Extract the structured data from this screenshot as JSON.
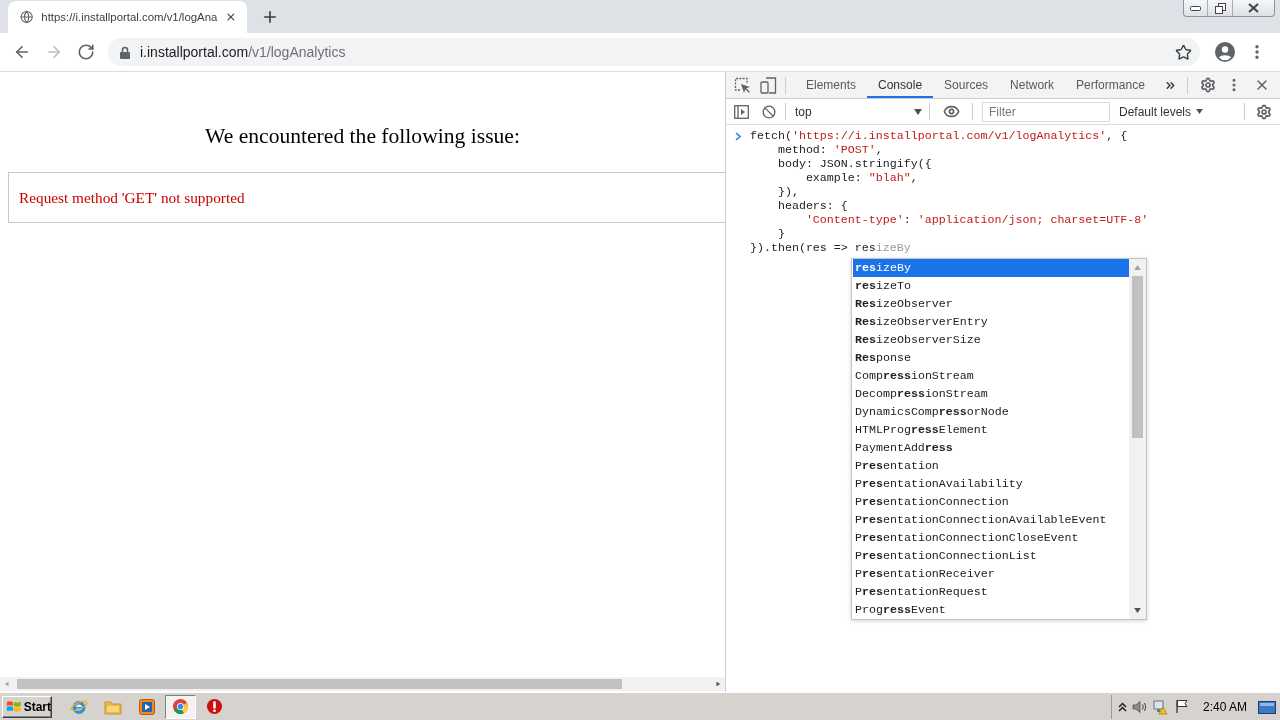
{
  "browser": {
    "tabs": [
      {
        "title": "https://i.installportal.com/v1/logAna",
        "selected": true
      }
    ],
    "nav_buttons": [
      {
        "kind": "back",
        "disabled": false
      },
      {
        "kind": "forward",
        "disabled": true
      },
      {
        "kind": "reload",
        "disabled": false
      }
    ],
    "address_bar": {
      "host": "i.installportal.com",
      "path": "/v1/logAnalytics"
    }
  },
  "page": {
    "heading": "We encountered the following issue:",
    "error": "Request method 'GET' not supported"
  },
  "devtools": {
    "tabs": [
      {
        "label": "Elements",
        "selected": false
      },
      {
        "label": "Console",
        "selected": true
      },
      {
        "label": "Sources",
        "selected": false
      },
      {
        "label": "Network",
        "selected": false
      },
      {
        "label": "Performance",
        "selected": false
      }
    ],
    "console_toolbar": {
      "context": "top",
      "filter": {
        "placeholder": "Filter"
      },
      "levels": "Default levels"
    },
    "console_lines": [
      {
        "tokens": [
          {
            "kind": "plain",
            "text": "fetch("
          },
          {
            "kind": "string",
            "text": "'https://i.installportal.com/v1/logAnalytics'"
          },
          {
            "kind": "plain",
            "text": ", {"
          }
        ],
        "children": [
          {
            "tokens": [
              {
                "kind": "plain",
                "text": "method: "
              },
              {
                "kind": "string",
                "text": "'POST'"
              },
              {
                "kind": "plain",
                "text": ","
              }
            ]
          },
          {
            "tokens": [
              {
                "kind": "plain",
                "text": "body: JSON.stringify({"
              }
            ],
            "children": [
              {
                "tokens": [
                  {
                    "kind": "plain",
                    "text": "example: "
                  },
                  {
                    "kind": "string",
                    "text": "\"blah\""
                  },
                  {
                    "kind": "plain",
                    "text": ","
                  }
                ]
              }
            ]
          },
          {
            "tokens": [
              {
                "kind": "plain",
                "text": "}),"
              }
            ]
          },
          {
            "tokens": [
              {
                "kind": "plain",
                "text": "headers: {"
              }
            ],
            "children": [
              {
                "tokens": [
                  {
                    "kind": "string",
                    "text": "'Content-type'"
                  },
                  {
                    "kind": "plain",
                    "text": ": "
                  },
                  {
                    "kind": "string",
                    "text": "'application/json; charset=UTF-8'"
                  }
                ]
              }
            ]
          },
          {
            "tokens": [
              {
                "kind": "plain",
                "text": "}"
              }
            ]
          }
        ]
      },
      {
        "tokens": [
          {
            "kind": "plain",
            "text": "}).then(res => res"
          },
          {
            "kind": "hint",
            "text": "izeBy"
          }
        ]
      }
    ],
    "autocomplete": [
      {
        "label": "**res**izeBy",
        "selected": true
      },
      {
        "label": "**res**izeTo",
        "selected": false
      },
      {
        "label": "**Res**izeObserver",
        "selected": false
      },
      {
        "label": "**Res**izeObserverEntry",
        "selected": false
      },
      {
        "label": "**Res**izeObserverSize",
        "selected": false
      },
      {
        "label": "**Res**ponse",
        "selected": false
      },
      {
        "label": "Comp**ress**ionStream",
        "selected": false
      },
      {
        "label": "Decomp**ress**ionStream",
        "selected": false
      },
      {
        "label": "DynamicsComp**ress**orNode",
        "selected": false
      },
      {
        "label": "HTMLProg**ress**Element",
        "selected": false
      },
      {
        "label": "PaymentAdd**ress**",
        "selected": false
      },
      {
        "label": "P**res**entation",
        "selected": false
      },
      {
        "label": "P**res**entationAvailability",
        "selected": false
      },
      {
        "label": "P**res**entationConnection",
        "selected": false
      },
      {
        "label": "P**res**entationConnectionAvailableEvent",
        "selected": false
      },
      {
        "label": "P**res**entationConnectionCloseEvent",
        "selected": false
      },
      {
        "label": "P**res**entationConnectionList",
        "selected": false
      },
      {
        "label": "P**res**entationReceiver",
        "selected": false
      },
      {
        "label": "P**res**entationRequest",
        "selected": false
      },
      {
        "label": "Prog**ress**Event",
        "selected": false
      }
    ]
  },
  "taskbar": {
    "start": "Start",
    "apps": [
      {
        "kind": "ie",
        "active": false
      },
      {
        "kind": "explorer",
        "active": false
      },
      {
        "kind": "media",
        "active": false
      },
      {
        "kind": "chrome",
        "active": true
      },
      {
        "kind": "stop",
        "active": false
      }
    ],
    "clock": "2:40 AM"
  }
}
